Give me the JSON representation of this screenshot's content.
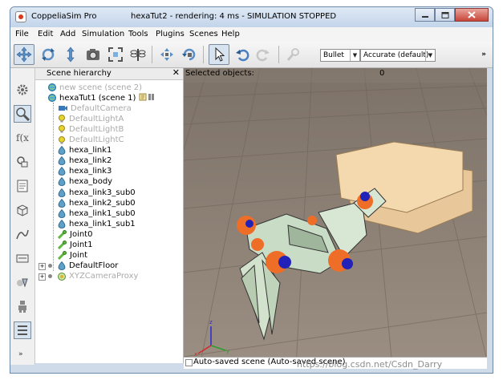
{
  "window": {
    "app_name": "CoppeliaSim Pro",
    "title": "hexaTut2 - rendering: 4 ms - SIMULATION STOPPED",
    "controls": [
      "minimize",
      "maximize",
      "close"
    ]
  },
  "menubar": [
    "File",
    "Edit",
    "Add",
    "Simulation",
    "Tools",
    "Plugins",
    "Scenes",
    "Help"
  ],
  "toolbar": {
    "buttons": [
      "camera-pan-icon",
      "camera-rotate-icon",
      "camera-shift-icon",
      "camera-angle-icon",
      "fit-to-view-icon",
      "manipulate-icon",
      "object-shift-icon",
      "object-rotate-icon",
      "click-select-icon",
      "undo-icon",
      "redo-icon",
      "simulation-settings-icon"
    ],
    "engine": "Bullet",
    "accuracy": "Accurate (default)",
    "overflow": "»"
  },
  "hierarchy": {
    "title": "Scene hierarchy",
    "close": "✕",
    "items": [
      {
        "label": "new scene (scene 2)",
        "icon": "world-icon",
        "dim": true
      },
      {
        "label": "hexaTut1 (scene 1)",
        "icon": "world-icon",
        "dim": false
      },
      {
        "label": "DefaultCamera",
        "icon": "camera-icon",
        "dim": true
      },
      {
        "label": "DefaultLightA",
        "icon": "light-icon",
        "dim": true
      },
      {
        "label": "DefaultLightB",
        "icon": "light-icon",
        "dim": true
      },
      {
        "label": "DefaultLightC",
        "icon": "light-icon",
        "dim": true
      },
      {
        "label": "hexa_link1",
        "icon": "shape-icon",
        "dim": false
      },
      {
        "label": "hexa_link2",
        "icon": "shape-icon",
        "dim": false
      },
      {
        "label": "hexa_link3",
        "icon": "shape-icon",
        "dim": false
      },
      {
        "label": "hexa_body",
        "icon": "shape-icon",
        "dim": false
      },
      {
        "label": "hexa_link3_sub0",
        "icon": "shape-icon",
        "dim": false
      },
      {
        "label": "hexa_link2_sub0",
        "icon": "shape-icon",
        "dim": false
      },
      {
        "label": "hexa_link1_sub0",
        "icon": "shape-icon",
        "dim": false
      },
      {
        "label": "hexa_link1_sub1",
        "icon": "shape-icon",
        "dim": false
      },
      {
        "label": "Joint0",
        "icon": "joint-icon",
        "dim": false
      },
      {
        "label": "Joint1",
        "icon": "joint-icon",
        "dim": false
      },
      {
        "label": "Joint",
        "icon": "joint-icon",
        "dim": false
      },
      {
        "label": "DefaultFloor",
        "icon": "shape-icon",
        "dim": false
      },
      {
        "label": "XYZCameraProxy",
        "icon": "dummy-icon",
        "dim": true
      }
    ]
  },
  "viewport": {
    "selected_label": "Selected objects:",
    "selected_count": "0"
  },
  "status": "Auto-saved scene (Auto-saved scene)",
  "watermark": "https://blog.csdn.net/Csdn_Darry",
  "colors": {
    "shape": "#5f9fc8",
    "joint": "#5fb83f",
    "light": "#e8d330",
    "camera": "#3b78b7",
    "floor": "#8a7b6b",
    "robot_orange": "#ee6e28",
    "robot_blue": "#2222b8"
  }
}
